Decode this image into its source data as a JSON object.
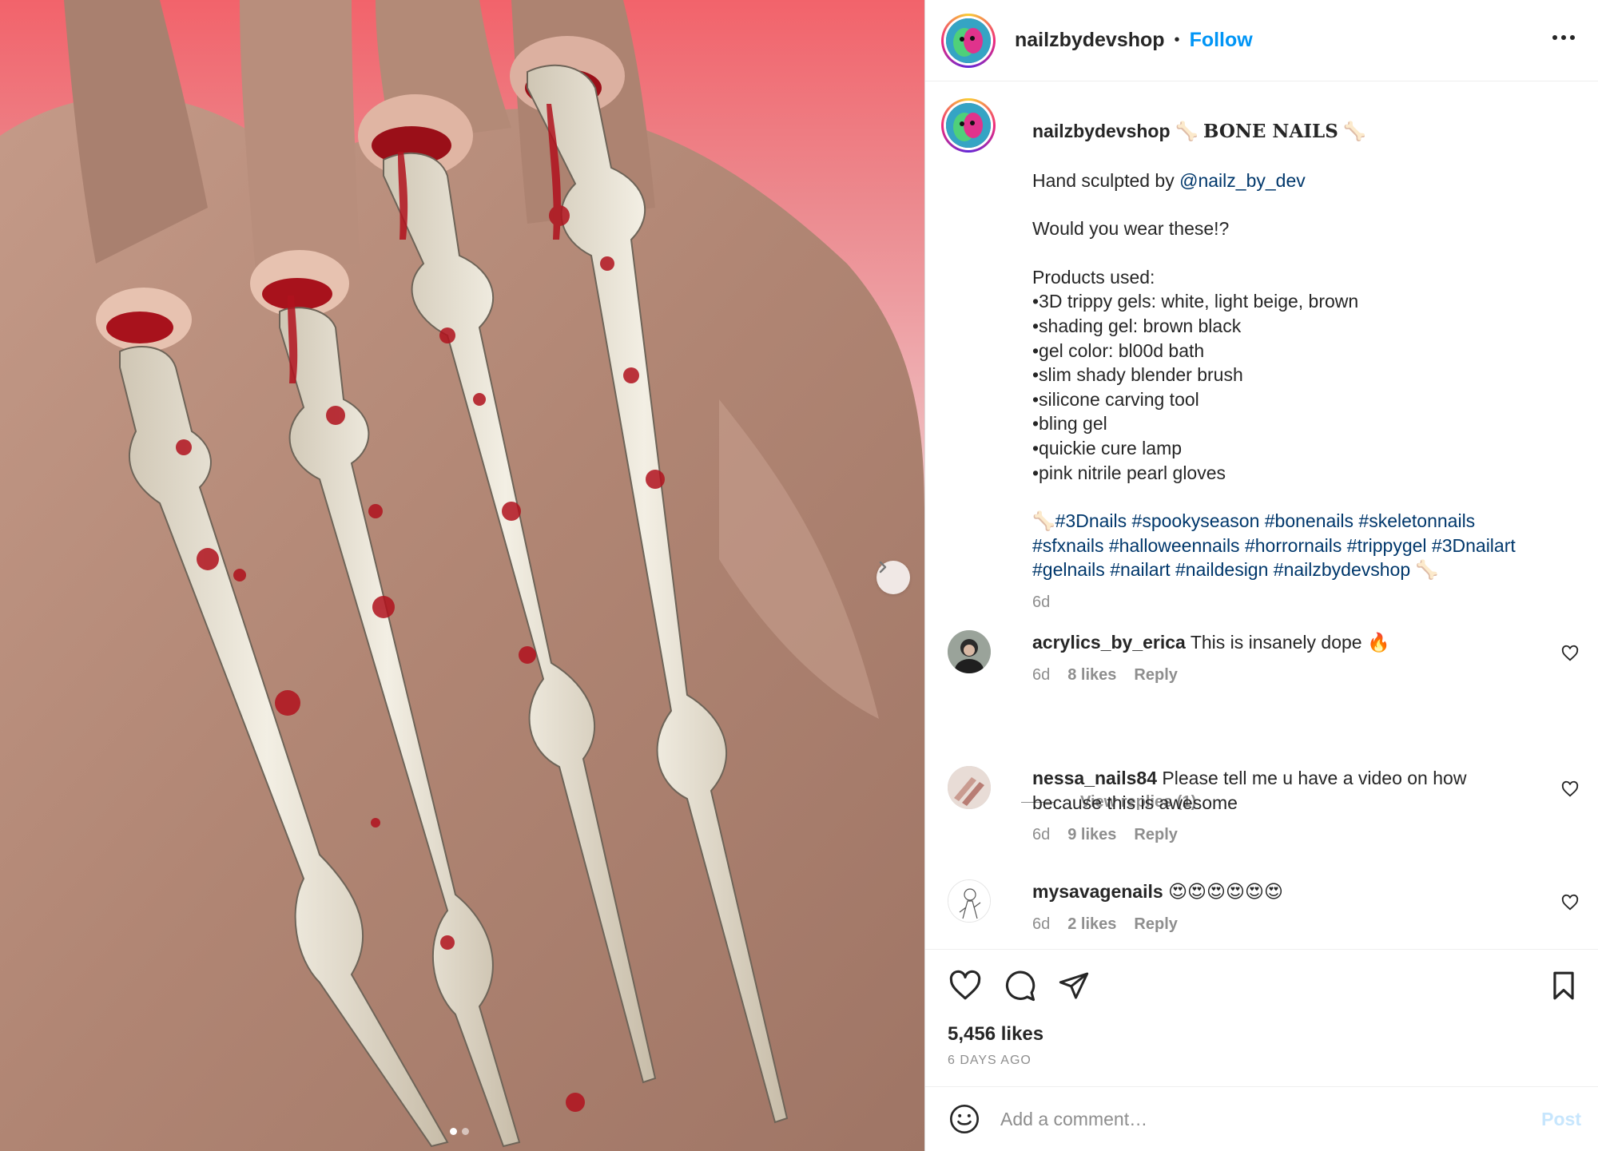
{
  "post": {
    "username": "nailzbydevshop",
    "separator": "•",
    "follow_label": "Follow",
    "more_options": "more-options-icon"
  },
  "caption": {
    "username": "nailzbydevshop",
    "bone_emoji": "🦴",
    "title": "BONE NAILS",
    "line_sculpted_prefix": "Hand sculpted by ",
    "line_sculpted_mention": "@nailz_by_dev",
    "question": "Would you wear these!?",
    "products_heading": "Products used:",
    "products": [
      "•3D trippy gels: white, light beige, brown",
      "•shading gel: brown black",
      "•gel color: bl00d bath",
      "•slim shady blender brush",
      "•silicone carving tool",
      "•bling gel",
      "•quickie cure lamp",
      "•pink nitrile pearl gloves"
    ],
    "hashtags_line1": [
      "#3Dnails",
      "#spookyseason",
      "#bonenails",
      "#skeletonnails"
    ],
    "hashtags_line2": [
      "#sfxnails",
      "#halloweennails",
      "#horrornails",
      "#trippygel",
      "#3Dnailart"
    ],
    "hashtags_line3": [
      "#gelnails",
      "#nailart",
      "#naildesign",
      "#nailzbydevshop"
    ],
    "timestamp": "6d"
  },
  "comments": [
    {
      "username": "acrylics_by_erica",
      "text": "This is insanely dope 🔥",
      "time": "6d",
      "likes": "8 likes",
      "reply": "Reply"
    },
    {
      "username": "nessa_nails84",
      "text": "Please tell me u have a video on how because this is awesome",
      "time": "6d",
      "likes": "9 likes",
      "reply": "Reply"
    },
    {
      "username": "mysavagenails",
      "text": "😍😍😍😍😍😍",
      "time": "6d",
      "likes": "2 likes",
      "reply": "Reply"
    }
  ],
  "view_replies": "View replies (1)",
  "actions": {
    "likes": "5,456 likes",
    "date": "6 DAYS AGO"
  },
  "comment_box": {
    "placeholder": "Add a comment…",
    "post_label": "Post"
  },
  "carousel": {
    "total_slides": 2,
    "current_slide": 1
  },
  "colors": {
    "link": "#00376b",
    "follow": "#0095f6",
    "muted": "#8e8e8e",
    "post_disabled": "#c7e6fd"
  }
}
